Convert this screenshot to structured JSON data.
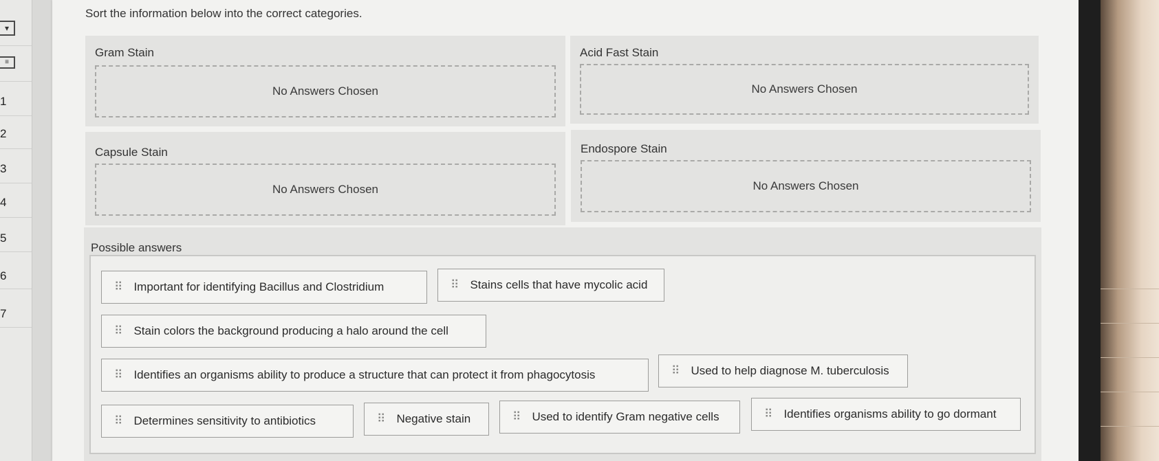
{
  "instructions": "Sort the information below into the correct categories.",
  "nav": {
    "numbers": [
      "1",
      "2",
      "3",
      "4",
      "5",
      "6",
      "7"
    ]
  },
  "categories": [
    {
      "title": "Gram Stain",
      "placeholder": "No Answers Chosen"
    },
    {
      "title": "Acid Fast Stain",
      "placeholder": "No Answers Chosen"
    },
    {
      "title": "Capsule Stain",
      "placeholder": "No Answers Chosen"
    },
    {
      "title": "Endospore Stain",
      "placeholder": "No Answers Chosen"
    }
  ],
  "possible_answers": {
    "title": "Possible answers",
    "items": [
      "Important for identifying Bacillus and Clostridium",
      "Stains cells that have mycolic acid",
      "Stain colors the background producing a halo around the cell",
      "Identifies an organisms ability to produce a structure that can protect it from phagocytosis",
      "Used to help diagnose M. tuberculosis",
      "Determines sensitivity to antibiotics",
      "Negative stain",
      "Used to identify Gram negative cells",
      "Identifies organisms ability to go dormant"
    ]
  },
  "icons": {
    "drag_handle": "drag-handle-icon"
  }
}
